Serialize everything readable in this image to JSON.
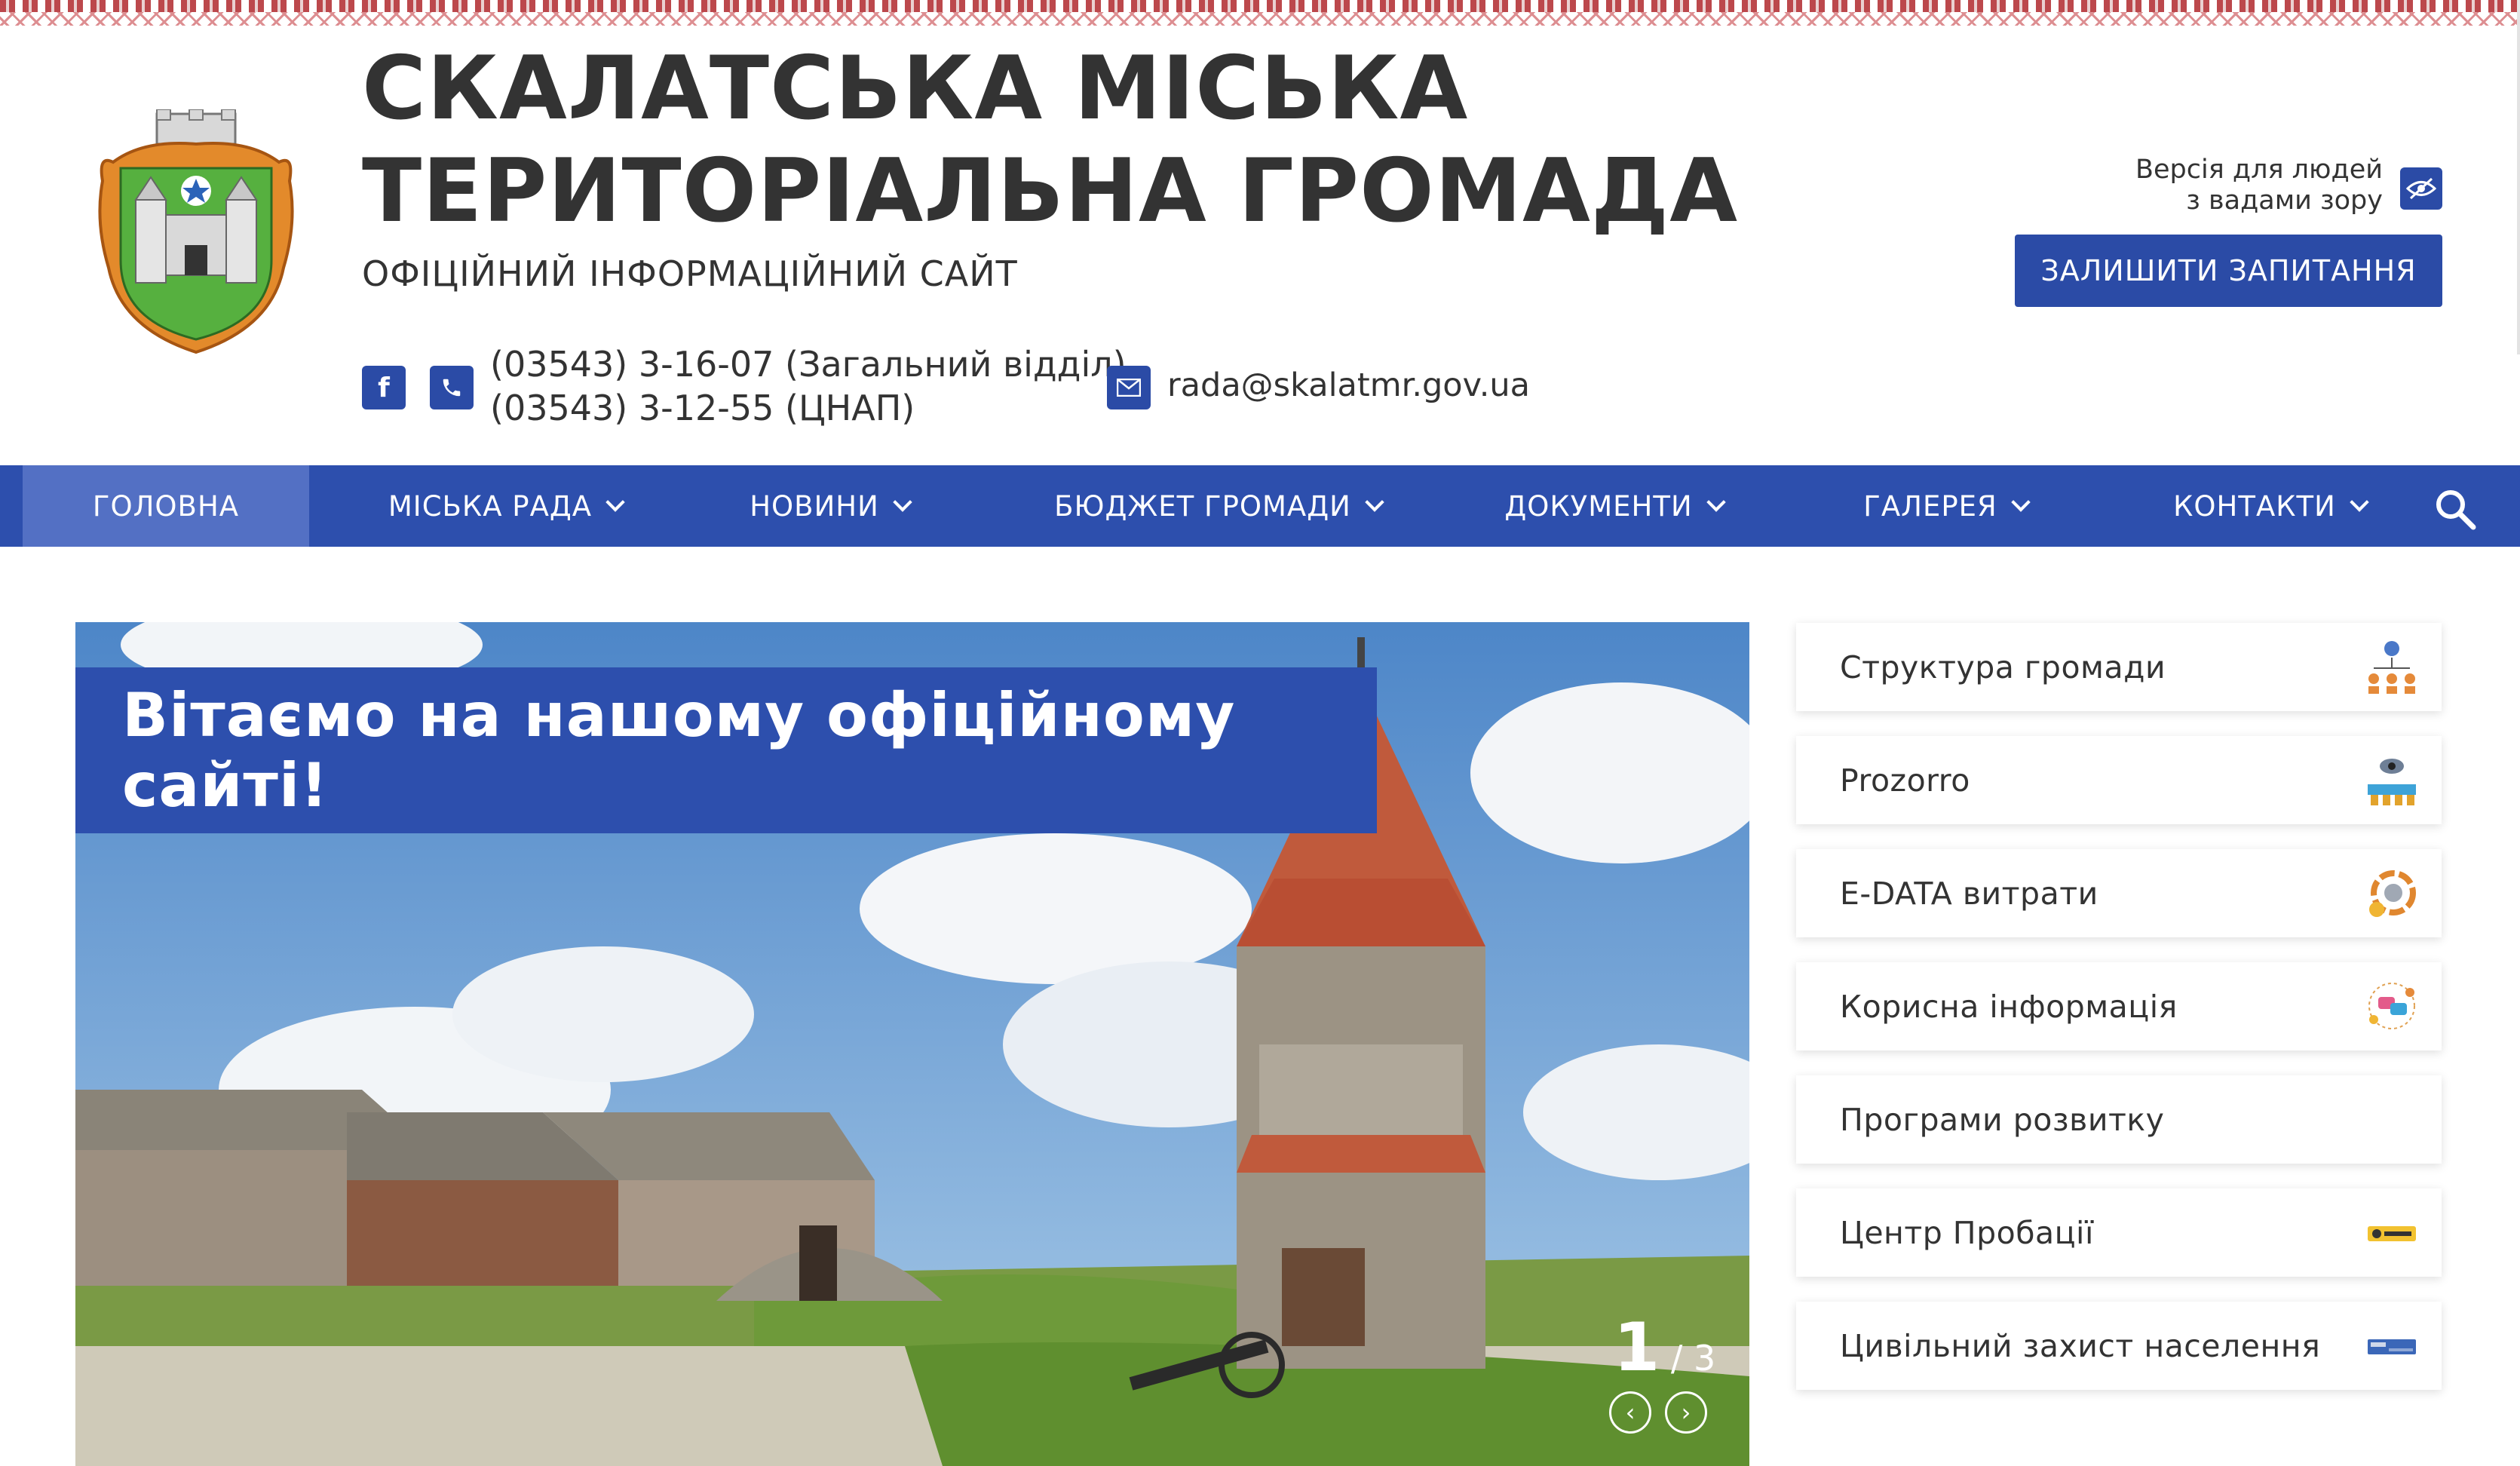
{
  "header": {
    "title": "СКАЛАТСЬКА МІСЬКА ТЕРИТОРІАЛЬНА ГРОМАДА",
    "subtitle": "ОФІЦІЙНИЙ ІНФОРМАЦІЙНИЙ САЙТ",
    "phone_1": "(03543) 3-16-07 (Загальний відділ)",
    "phone_2": "(03543) 3-12-55 (ЦНАП)",
    "email": "rada@skalatmr.gov.ua",
    "vision_line_1": "Версія для людей",
    "vision_line_2": "з вадами зору",
    "ask_button": "ЗАЛИШИТИ ЗАПИТАННЯ",
    "facebook_letter": "f"
  },
  "nav": {
    "items": [
      {
        "label": "ГОЛОВНА"
      },
      {
        "label": "МІСЬКА РАДА"
      },
      {
        "label": "НОВИНИ"
      },
      {
        "label": "БЮДЖЕТ ГРОМАДИ"
      },
      {
        "label": "ДОКУМЕНТИ"
      },
      {
        "label": "ГАЛЕРЕЯ"
      },
      {
        "label": "КОНТАКТИ"
      }
    ]
  },
  "slider": {
    "title": "Вітаємо на нашому офіційному сайті!",
    "current": "1",
    "total": "/ 3"
  },
  "sidebar": {
    "items": [
      {
        "label": "Структура громади",
        "icon": "org-structure-icon"
      },
      {
        "label": "Prozorro",
        "icon": "prozorro-icon"
      },
      {
        "label": "E-DATA витрати",
        "icon": "edata-icon"
      },
      {
        "label": "Корисна інформація",
        "icon": "info-chat-icon"
      },
      {
        "label": "Програми розвитку",
        "icon": ""
      },
      {
        "label": "Центр Пробації",
        "icon": "probation-icon"
      },
      {
        "label": "Цивільний захист населення",
        "icon": "civil-defense-icon"
      }
    ]
  },
  "colors": {
    "brand_blue": "#2d4fad",
    "nav_active": "#5370c4",
    "ornament_red": "#c0262a"
  }
}
